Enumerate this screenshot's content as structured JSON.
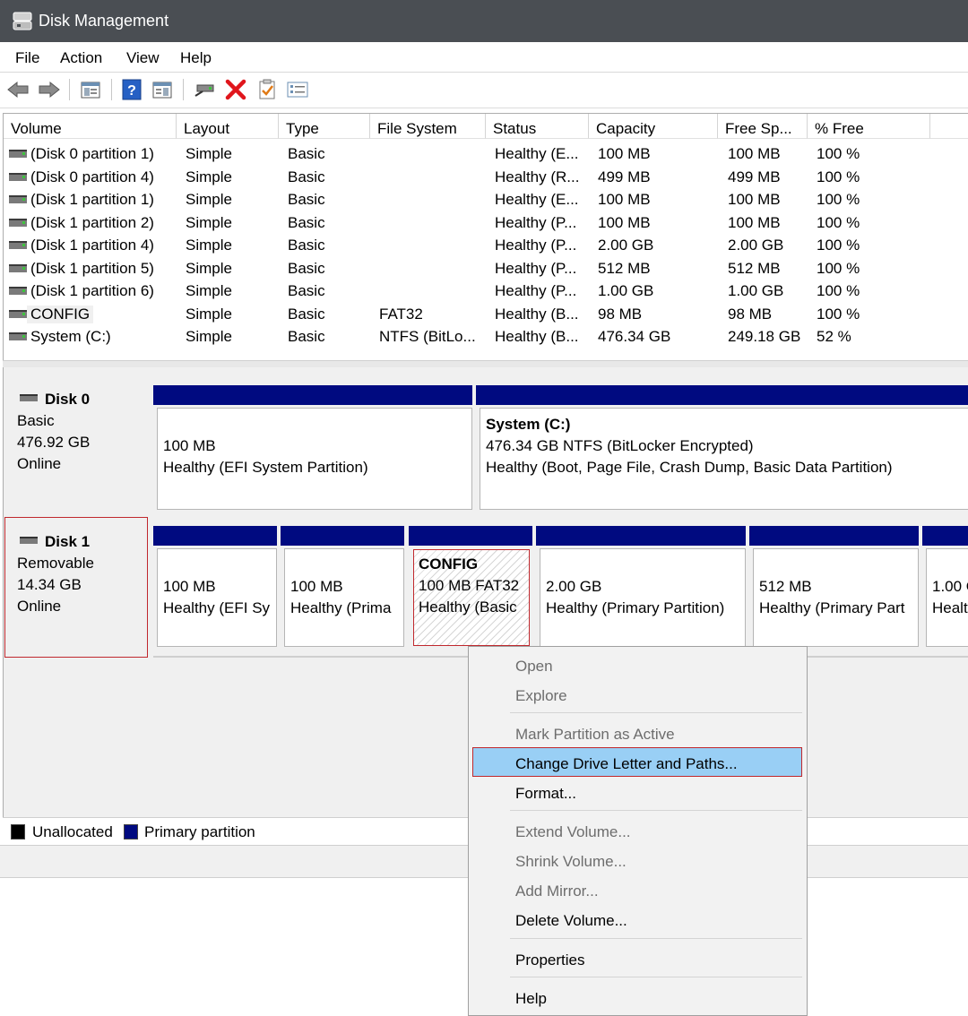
{
  "window": {
    "title": "Disk Management",
    "icon": "disk-management-icon"
  },
  "menubar": {
    "items": [
      "File",
      "Action",
      "View",
      "Help"
    ]
  },
  "toolbar": {
    "icons": [
      "back-arrow-icon",
      "forward-arrow-icon",
      "console-tree-icon",
      "help-icon",
      "properties-pane-icon",
      "connect-drive-icon",
      "delete-icon",
      "check-document-icon",
      "settings-list-icon"
    ]
  },
  "volume_table": {
    "columns": [
      "Volume",
      "Layout",
      "Type",
      "File System",
      "Status",
      "Capacity",
      "Free Sp...",
      "% Free"
    ],
    "rows": [
      [
        "(Disk 0 partition 1)",
        "Simple",
        "Basic",
        "",
        "Healthy (E...",
        "100 MB",
        "100 MB",
        "100 %"
      ],
      [
        "(Disk 0 partition 4)",
        "Simple",
        "Basic",
        "",
        "Healthy (R...",
        "499 MB",
        "499 MB",
        "100 %"
      ],
      [
        "(Disk 1 partition 1)",
        "Simple",
        "Basic",
        "",
        "Healthy (E...",
        "100 MB",
        "100 MB",
        "100 %"
      ],
      [
        "(Disk 1 partition 2)",
        "Simple",
        "Basic",
        "",
        "Healthy (P...",
        "100 MB",
        "100 MB",
        "100 %"
      ],
      [
        "(Disk 1 partition 4)",
        "Simple",
        "Basic",
        "",
        "Healthy (P...",
        "2.00 GB",
        "2.00 GB",
        "100 %"
      ],
      [
        "(Disk 1 partition 5)",
        "Simple",
        "Basic",
        "",
        "Healthy (P...",
        "512 MB",
        "512 MB",
        "100 %"
      ],
      [
        "(Disk 1 partition 6)",
        "Simple",
        "Basic",
        "",
        "Healthy (P...",
        "1.00 GB",
        "1.00 GB",
        "100 %"
      ],
      [
        "CONFIG",
        "Simple",
        "Basic",
        "FAT32",
        "Healthy (B...",
        "98 MB",
        "98 MB",
        "100 %"
      ],
      [
        "System (C:)",
        "Simple",
        "Basic",
        "NTFS (BitLo...",
        "Healthy (B...",
        "476.34 GB",
        "249.18 GB",
        "52 %"
      ]
    ]
  },
  "disks": [
    {
      "name": "Disk 0",
      "type": "Basic",
      "size": "476.92 GB",
      "status": "Online",
      "partitions": [
        {
          "title": "",
          "line1": "100 MB",
          "line2": "Healthy (EFI System Partition)"
        },
        {
          "title": "System  (C:)",
          "line1": "476.34 GB NTFS (BitLocker Encrypted)",
          "line2": "Healthy (Boot, Page File, Crash Dump, Basic Data Partition)"
        }
      ]
    },
    {
      "name": "Disk 1",
      "type": "Removable",
      "size": "14.34 GB",
      "status": "Online",
      "partitions": [
        {
          "title": "",
          "line1": "100 MB",
          "line2": "Healthy (EFI Sy"
        },
        {
          "title": "",
          "line1": "100 MB",
          "line2": "Healthy (Prima"
        },
        {
          "title": "CONFIG",
          "line1": "100 MB FAT32",
          "line2": "Healthy (Basic"
        },
        {
          "title": "",
          "line1": "2.00 GB",
          "line2": "Healthy (Primary Partition)"
        },
        {
          "title": "",
          "line1": "512 MB",
          "line2": "Healthy (Primary Part"
        },
        {
          "title": "",
          "line1": "1.00 G",
          "line2": "Healt"
        }
      ]
    }
  ],
  "legend": {
    "unallocated": "Unallocated",
    "primary": "Primary partition",
    "unallocated_color": "#000000",
    "primary_color": "#000a80"
  },
  "context_menu": {
    "items": [
      {
        "label": "Open",
        "enabled": false
      },
      {
        "label": "Explore",
        "enabled": false
      },
      {
        "label": "Mark Partition as Active",
        "enabled": false
      },
      {
        "label": "Change Drive Letter and Paths...",
        "enabled": true,
        "highlighted": true
      },
      {
        "label": "Format...",
        "enabled": true
      },
      {
        "label": "Extend Volume...",
        "enabled": false
      },
      {
        "label": "Shrink Volume...",
        "enabled": false
      },
      {
        "label": "Add Mirror...",
        "enabled": false
      },
      {
        "label": "Delete Volume...",
        "enabled": true
      },
      {
        "label": "Properties",
        "enabled": true
      },
      {
        "label": "Help",
        "enabled": true
      }
    ]
  },
  "colors": {
    "titlebar": "#4a4e53",
    "partition_bar": "#000a80",
    "menu_highlight": "#99cff5",
    "selection_border": "#c0282d"
  }
}
